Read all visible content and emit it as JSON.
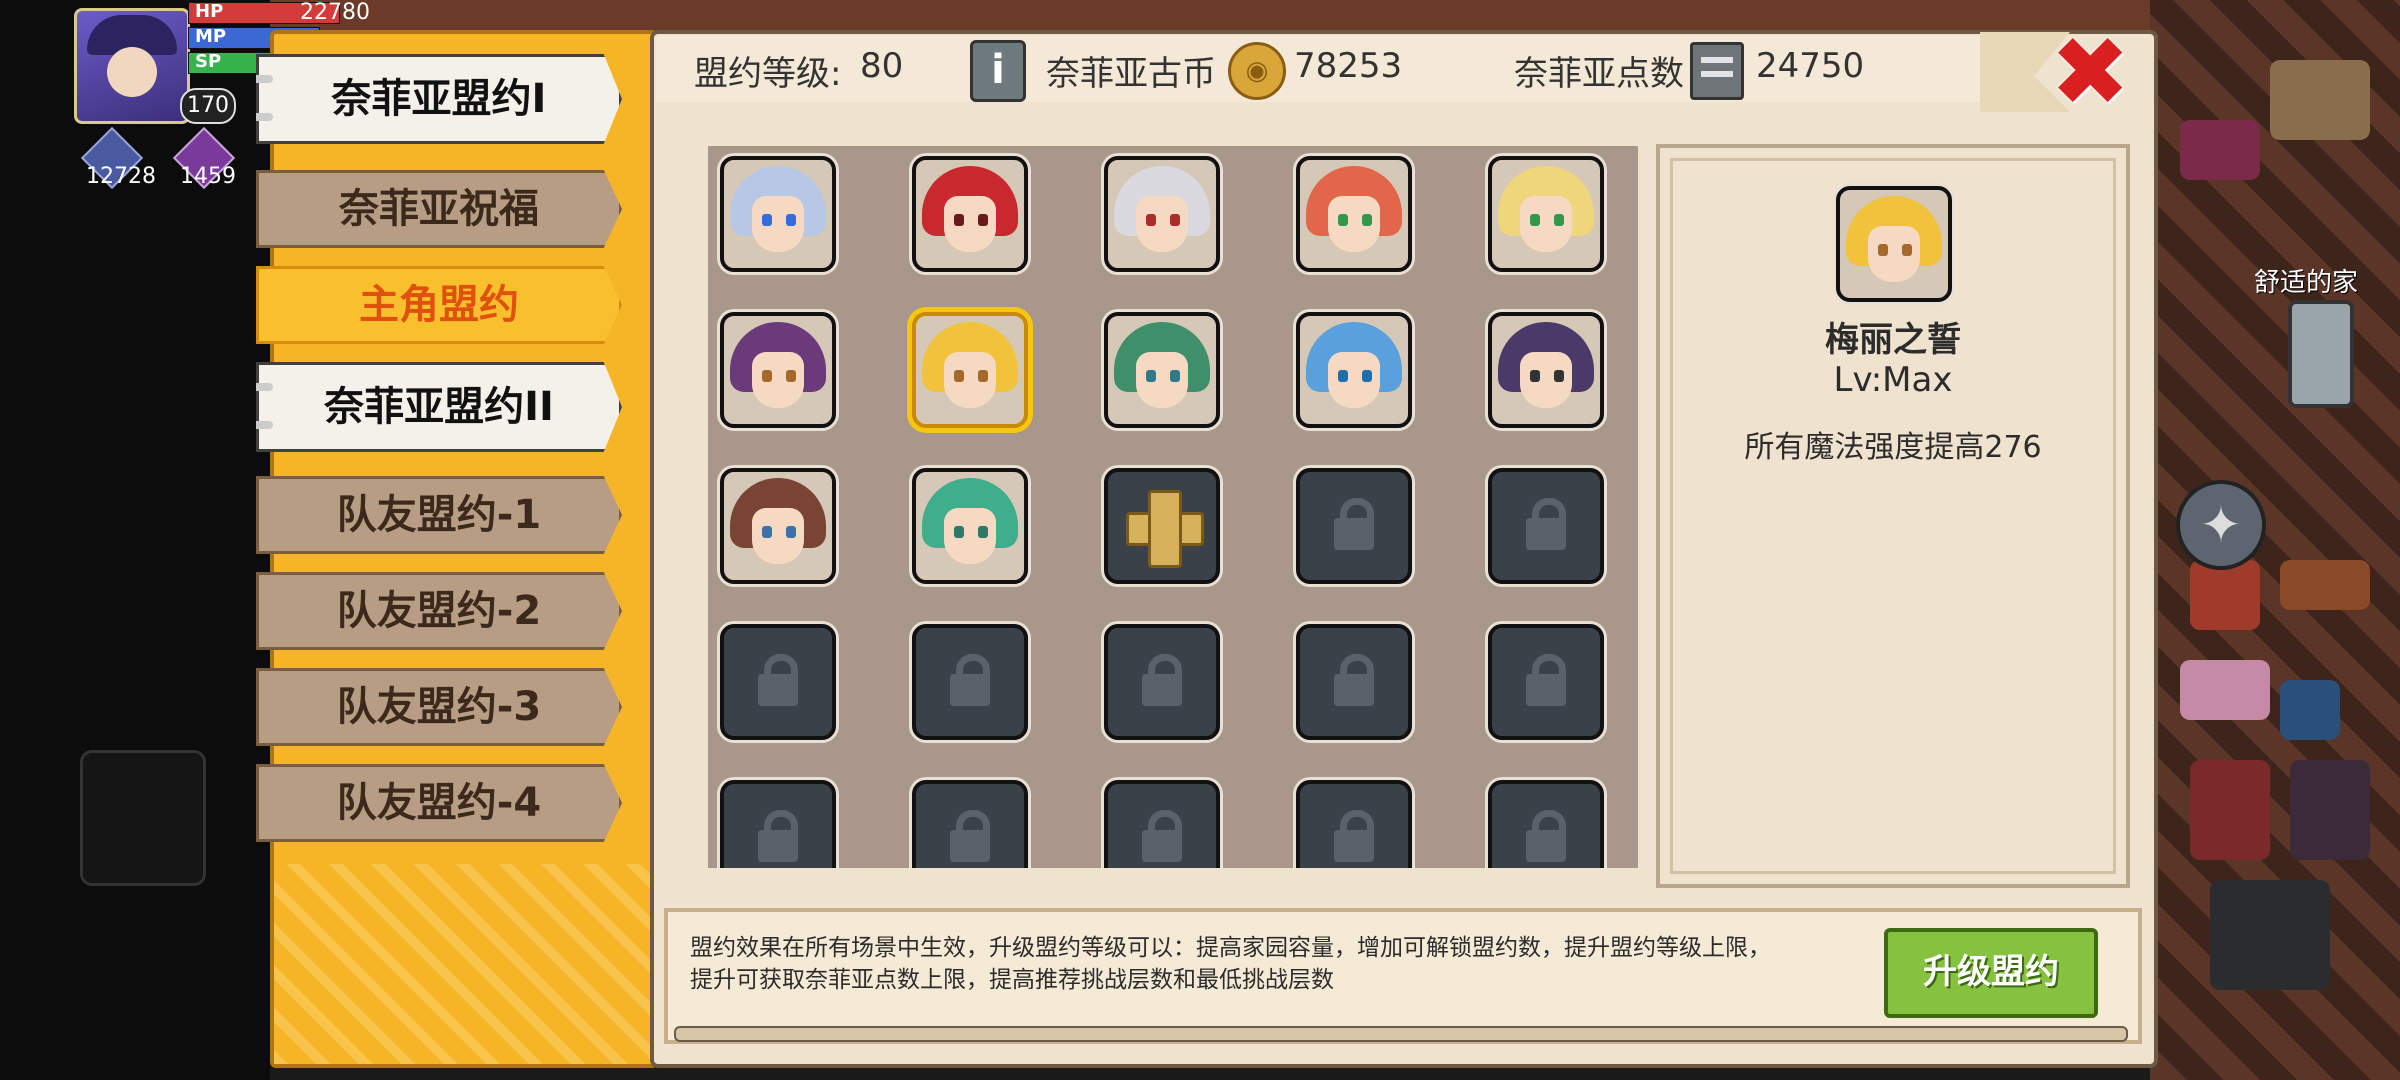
{
  "hud": {
    "hp_label": "HP",
    "hp_value": "22780",
    "mp_label": "MP",
    "sp_label": "SP",
    "level": "170",
    "currency_1": "12728",
    "currency_2": "1459"
  },
  "tabs": [
    {
      "label": "奈菲亚盟约I",
      "style": "major"
    },
    {
      "label": "奈菲亚祝福",
      "style": "normal"
    },
    {
      "label": "主角盟约",
      "style": "active"
    },
    {
      "label": "奈菲亚盟约II",
      "style": "major"
    },
    {
      "label": "队友盟约-1",
      "style": "normal"
    },
    {
      "label": "队友盟约-2",
      "style": "normal"
    },
    {
      "label": "队友盟约-3",
      "style": "normal"
    },
    {
      "label": "队友盟约-4",
      "style": "normal"
    }
  ],
  "header": {
    "level_label": "盟约等级:",
    "level_value": "80",
    "coin_label": "奈菲亚古币",
    "coin_value": "78253",
    "points_label": "奈菲亚点数",
    "points_value": "24750"
  },
  "slots": [
    {
      "type": "portrait",
      "hair": "#b7c7e6",
      "eye": "#2f6fd8"
    },
    {
      "type": "portrait",
      "hair": "#c8282e",
      "eye": "#6a1a1a"
    },
    {
      "type": "portrait",
      "hair": "#d9d9df",
      "eye": "#b02a2a"
    },
    {
      "type": "portrait",
      "hair": "#e2674a",
      "eye": "#2f9a4c"
    },
    {
      "type": "portrait",
      "hair": "#f0d67a",
      "eye": "#2f9a4c"
    },
    {
      "type": "portrait",
      "hair": "#6a3a7a",
      "eye": "#a56a2a"
    },
    {
      "type": "portrait",
      "hair": "#f1c23b",
      "eye": "#a56a2a",
      "selected": true
    },
    {
      "type": "portrait",
      "hair": "#3f8f6a",
      "eye": "#2f7a8a"
    },
    {
      "type": "portrait",
      "hair": "#5aa0dd",
      "eye": "#1f6fae"
    },
    {
      "type": "portrait",
      "hair": "#4a3a6a",
      "eye": "#333333"
    },
    {
      "type": "portrait",
      "hair": "#7a4434",
      "eye": "#3a6fb0"
    },
    {
      "type": "portrait",
      "hair": "#3fae8c",
      "eye": "#2a7a6a"
    },
    {
      "type": "add"
    },
    {
      "type": "locked"
    },
    {
      "type": "locked"
    },
    {
      "type": "locked"
    },
    {
      "type": "locked"
    },
    {
      "type": "locked"
    },
    {
      "type": "locked"
    },
    {
      "type": "locked"
    },
    {
      "type": "locked"
    },
    {
      "type": "locked"
    },
    {
      "type": "locked"
    },
    {
      "type": "locked"
    },
    {
      "type": "locked"
    }
  ],
  "detail": {
    "name": "梅丽之誓",
    "level": "Lv:Max",
    "effect": "所有魔法强度提高276",
    "hair": "#f1c23b",
    "eye": "#a56a2a"
  },
  "description": {
    "line1": "盟约效果在所有场景中生效，升级盟约等级可以：提高家园容量，增加可解锁盟约数，提升盟约等级上限，",
    "line2": "提升可获取奈菲亚点数上限，提高推荐挑战层数和最低挑战层数"
  },
  "upgrade_button": "升级盟约",
  "world": {
    "home_label": "舒适的家"
  },
  "colors": {
    "accent_orange": "#f6b526",
    "active_tab_text": "#e0510f",
    "close_red": "#d91f1f",
    "upgrade_green": "#86c240"
  }
}
